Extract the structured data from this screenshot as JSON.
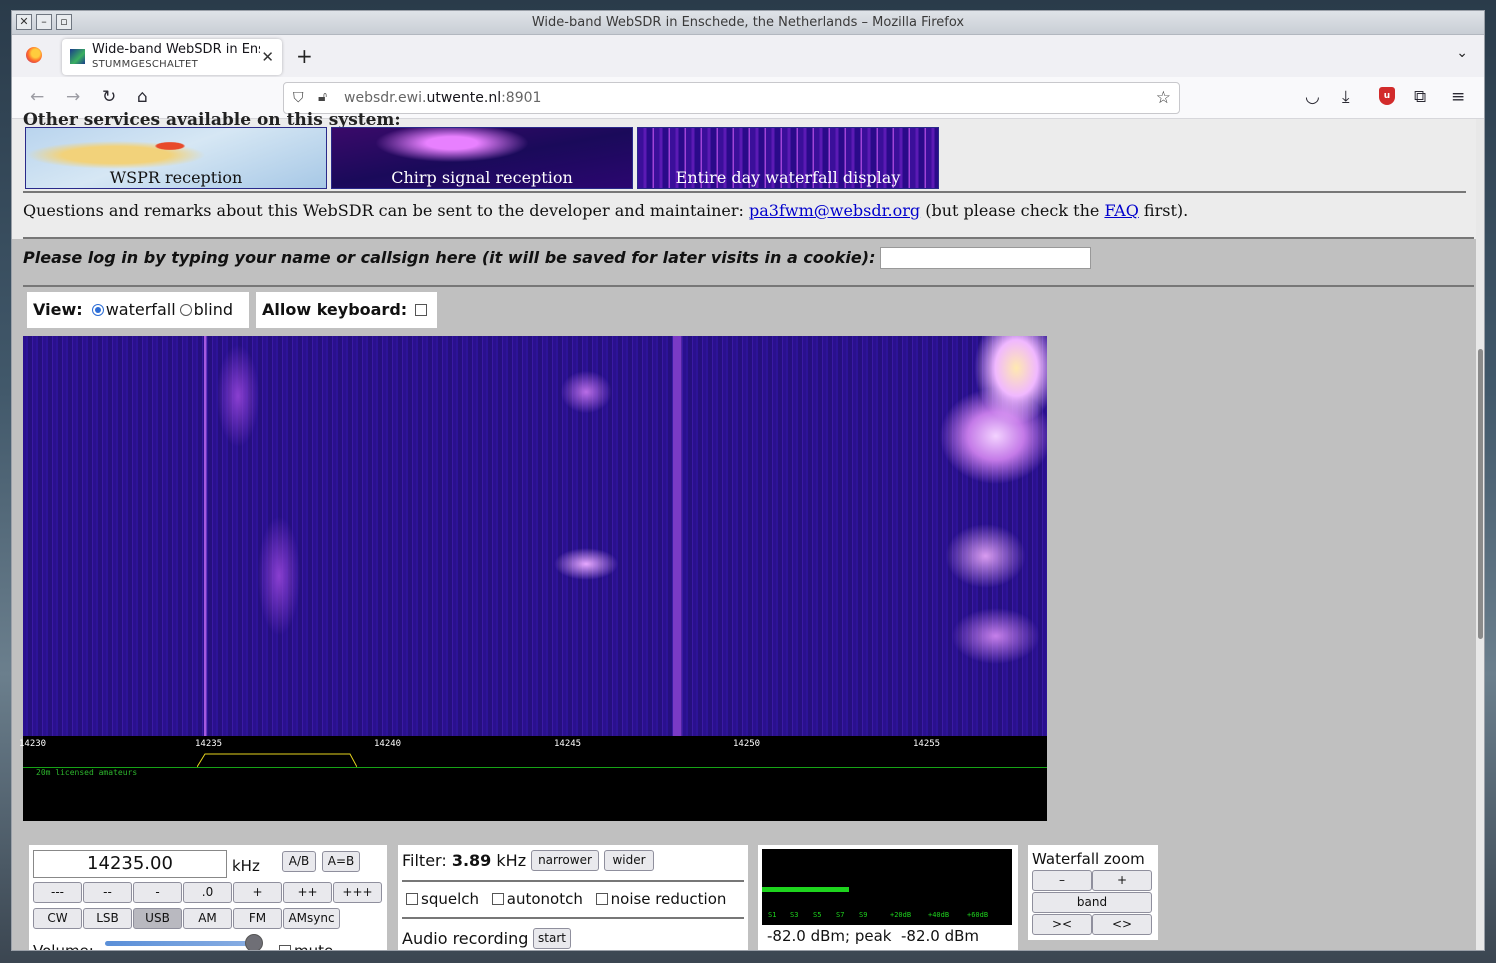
{
  "window": {
    "title": "Wide-band WebSDR in Enschede, the Netherlands – Mozilla Firefox"
  },
  "tab": {
    "title": "Wide-band WebSDR in Enschede, the Netherlands",
    "subtitle": "STUMMGESCHALTET"
  },
  "url": {
    "prefix": "websdr.ewi.",
    "host": "utwente.nl",
    "port": ":8901"
  },
  "page": {
    "cut_heading": "Other services available on this system:",
    "services": [
      "WSPR reception",
      "Chirp signal reception",
      "Entire day waterfall display"
    ],
    "questions_text": "Questions and remarks about this WebSDR can be sent to the developer and maintainer:",
    "email": "pa3fwm@websdr.org",
    "questions_mid": "(but please check the",
    "faq": "FAQ",
    "questions_end": "first).",
    "login_prompt": "Please log in by typing your name or callsign here (it will be saved for later visits in a cookie):",
    "view_label": "View:",
    "view_options": [
      "waterfall",
      "blind"
    ],
    "view_selected": "waterfall",
    "keyboard_label": "Allow keyboard:"
  },
  "scale": {
    "ticks": [
      "14230",
      "14235",
      "14240",
      "14245",
      "14250",
      "14255"
    ],
    "band_label": "20m licensed amateurs"
  },
  "tuning": {
    "frequency": "14235.00",
    "unit": "kHz",
    "ab": "A/B",
    "a_eq_b": "A=B",
    "step_buttons": [
      "---",
      "--",
      "-",
      ".0",
      "+",
      "++",
      "+++"
    ],
    "modes": [
      "CW",
      "LSB",
      "USB",
      "AM",
      "FM",
      "AMsync"
    ],
    "mode_selected": "USB",
    "volume_label": "Volume:",
    "volume_level": 1.0,
    "mute_label": "mute"
  },
  "filter": {
    "label": "Filter:",
    "bandwidth": "3.89",
    "unit": "kHz",
    "narrower": "narrower",
    "wider": "wider",
    "squelch": "squelch",
    "autonotch": "autonotch",
    "noise_reduction": "noise reduction",
    "recording_label": "Audio recording",
    "start": "start"
  },
  "smeter": {
    "labels": [
      "S1",
      "S3",
      "S5",
      "S7",
      "S9",
      "+20dB",
      "+40dB",
      "+60dB"
    ],
    "readout": "-82.0 dBm; peak  -82.0 dBm",
    "level_dbm": -82.0
  },
  "zoom": {
    "title": "Waterfall zoom",
    "minus": "–",
    "plus": "+",
    "band": "band",
    "narrow": "><",
    "wide": "<>"
  }
}
